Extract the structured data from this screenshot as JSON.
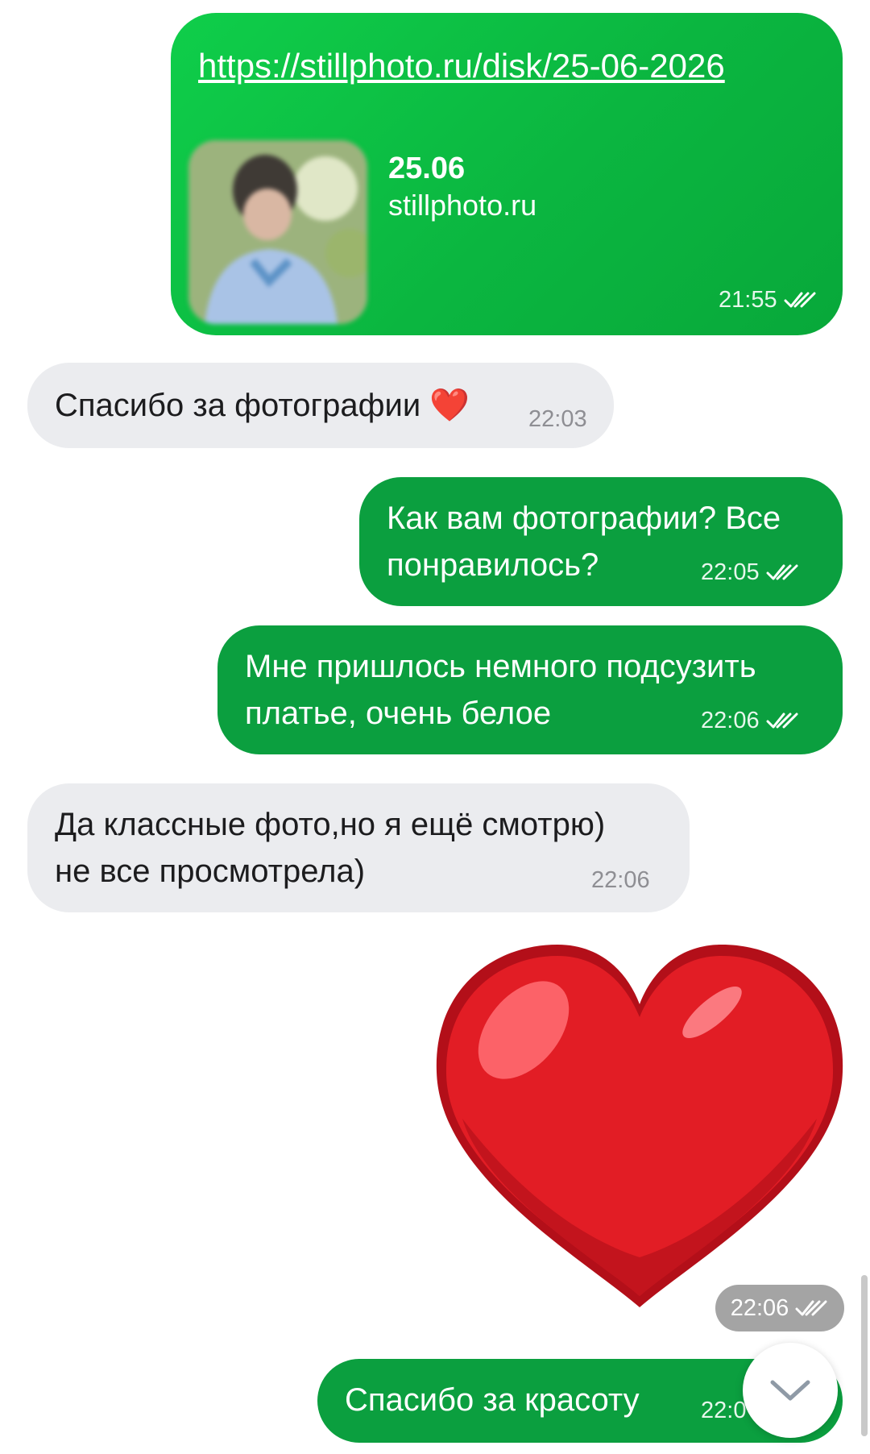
{
  "messages": {
    "link": {
      "url": "https://stillphoto.ru/disk/25-06-2026",
      "preview_title": "25.06",
      "preview_domain": "stillphoto.ru",
      "time": "21:55"
    },
    "m1": {
      "text": "Спасибо за фотографии ❤️",
      "time": "22:03"
    },
    "m2": {
      "line1": "Как вам фотографии? Все",
      "line2": "понравилось?",
      "time": "22:05"
    },
    "m3": {
      "line1": "Мне пришлось немного подсузить",
      "line2": "платье, очень белое",
      "time": "22:06"
    },
    "m4": {
      "line1": "Да классные фото,но я ещё смотрю)",
      "line2": "не все просмотрела)",
      "time": "22:06"
    },
    "sticker": {
      "time": "22:06"
    },
    "m5": {
      "text": "Спасибо за красоту",
      "time": "22:0"
    }
  },
  "colors": {
    "outgoing": "#0b9f3f",
    "link_bubble": "#0bc244",
    "incoming": "#ebecef",
    "heart": "#e21d25"
  },
  "icons": [
    "double-check-icon",
    "chevron-down-icon",
    "heart-sticker",
    "link-preview-thumbnail"
  ]
}
